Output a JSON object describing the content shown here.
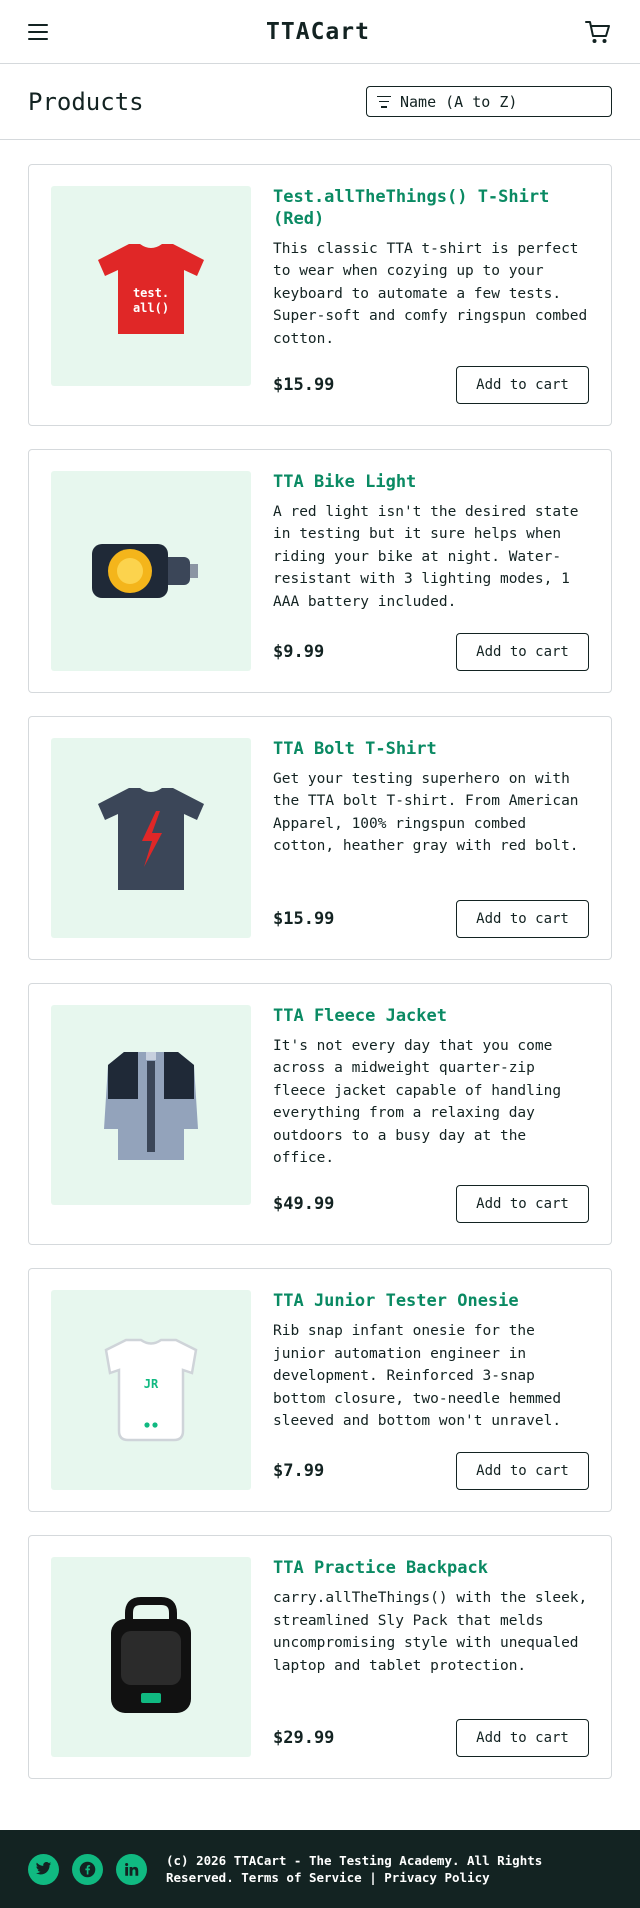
{
  "app": {
    "logo": "TTACart"
  },
  "header": {
    "menu_icon": "hamburger-menu-icon",
    "cart_icon": "shopping-cart-icon"
  },
  "page": {
    "title": "Products",
    "sort": {
      "icon": "filter-lines-icon",
      "selected": "Name (A to Z)"
    }
  },
  "products": [
    {
      "name": "Test.allTheThings() T-Shirt (Red)",
      "description": "This classic TTA t-shirt is perfect to wear when cozying up to your keyboard to automate a few tests. Super-soft and comfy ringspun combed cotton.",
      "price": "$15.99",
      "button": "Add to cart",
      "image_icon": "red-tshirt-image",
      "shirt_print": [
        "test.",
        "all()"
      ]
    },
    {
      "name": "TTA Bike Light",
      "description": "A red light isn't the desired state in testing but it sure helps when riding your bike at night. Water-resistant with 3 lighting modes, 1 AAA battery included.",
      "price": "$9.99",
      "button": "Add to cart",
      "image_icon": "bike-light-image"
    },
    {
      "name": "TTA Bolt T-Shirt",
      "description": "Get your testing superhero on with the TTA bolt T-shirt. From American Apparel, 100% ringspun combed cotton, heather gray with red bolt.",
      "price": "$15.99",
      "button": "Add to cart",
      "image_icon": "bolt-tshirt-image"
    },
    {
      "name": "TTA Fleece Jacket",
      "description": "It's not every day that you come across a midweight quarter-zip fleece jacket capable of handling everything from a relaxing day outdoors to a busy day at the office.",
      "price": "$49.99",
      "button": "Add to cart",
      "image_icon": "fleece-jacket-image"
    },
    {
      "name": "TTA Junior Tester Onesie",
      "description": "Rib snap infant onesie for the junior automation engineer in development. Reinforced 3-snap bottom closure, two-needle hemmed sleeved and bottom won't unravel.",
      "price": "$7.99",
      "button": "Add to cart",
      "image_icon": "onesie-image",
      "onesie_print": "JR"
    },
    {
      "name": "TTA Practice Backpack",
      "description": "carry.allTheThings() with the sleek, streamlined Sly Pack that melds uncompromising style with unequaled laptop and tablet protection.",
      "price": "$29.99",
      "button": "Add to cart",
      "image_icon": "backpack-image"
    }
  ],
  "footer": {
    "social": [
      "twitter-icon",
      "facebook-icon",
      "linkedin-icon"
    ],
    "copyright": "(c) 2026 TTACart - The Testing Academy. All Rights Reserved.",
    "terms": "Terms of Service",
    "separator": "|",
    "privacy": "Privacy Policy"
  },
  "colors": {
    "accent": "#0a8a63",
    "social_green": "#10b981",
    "footer_bg": "#132322",
    "image_bg": "#e7f7ee",
    "text": "#132322"
  }
}
